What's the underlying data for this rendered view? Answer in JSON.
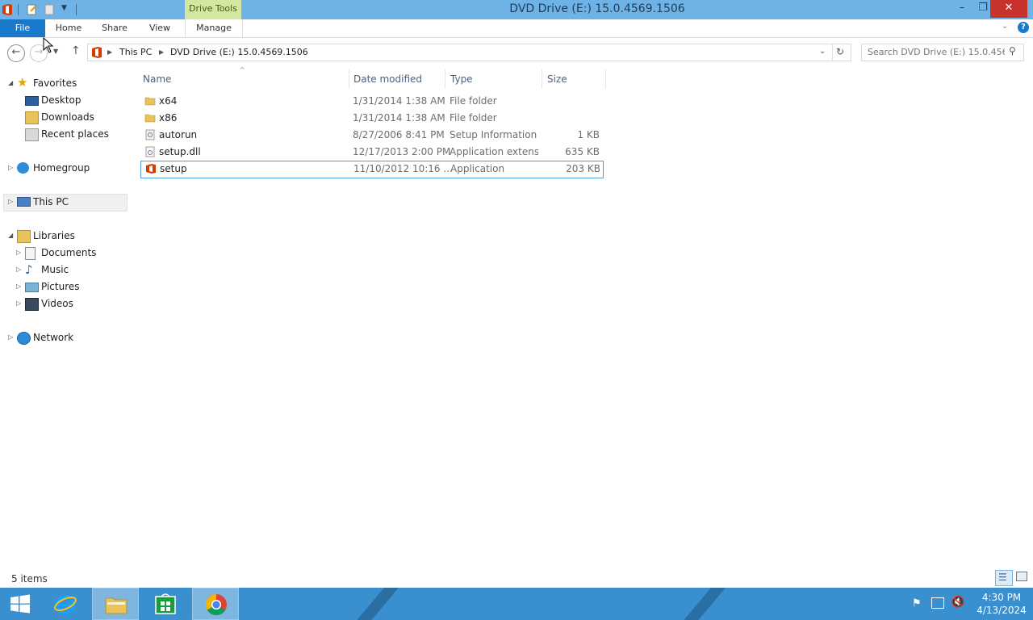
{
  "window": {
    "title": "DVD Drive (E:) 15.0.4569.1506",
    "contextual_tab": "Drive Tools"
  },
  "ribbon": {
    "tabs": [
      {
        "label": "File"
      },
      {
        "label": "Home"
      },
      {
        "label": "Share"
      },
      {
        "label": "View"
      },
      {
        "label": "Manage"
      }
    ]
  },
  "address": {
    "crumbs": [
      "This PC",
      "DVD Drive (E:) 15.0.4569.1506"
    ],
    "search_placeholder": "Search DVD Drive (E:) 15.0.456..."
  },
  "nav": {
    "favorites": {
      "label": "Favorites",
      "items": [
        "Desktop",
        "Downloads",
        "Recent places"
      ]
    },
    "homegroup": "Homegroup",
    "this_pc": "This PC",
    "libraries": {
      "label": "Libraries",
      "items": [
        "Documents",
        "Music",
        "Pictures",
        "Videos"
      ]
    },
    "network": "Network"
  },
  "columns": {
    "name": "Name",
    "date": "Date modified",
    "type": "Type",
    "size": "Size"
  },
  "files": [
    {
      "name": "x64",
      "date": "1/31/2014 1:38 AM",
      "type": "File folder",
      "size": "",
      "icon": "folder-icon"
    },
    {
      "name": "x86",
      "date": "1/31/2014 1:38 AM",
      "type": "File folder",
      "size": "",
      "icon": "folder-icon"
    },
    {
      "name": "autorun",
      "date": "8/27/2006 8:41 PM",
      "type": "Setup Information",
      "size": "1 KB",
      "icon": "setup-info-icon"
    },
    {
      "name": "setup.dll",
      "date": "12/17/2013 2:00 PM",
      "type": "Application extens...",
      "size": "635 KB",
      "icon": "dll-icon"
    },
    {
      "name": "setup",
      "date": "11/10/2012 10:16 ...",
      "type": "Application",
      "size": "203 KB",
      "icon": "office-icon"
    }
  ],
  "status": {
    "item_count": "5 items"
  },
  "clock": {
    "time": "4:30 PM",
    "date": "4/13/2024"
  },
  "colors": {
    "title_bar": "#6fb3e6",
    "file_tab": "#1979ca",
    "taskbar": "#3a8fcf",
    "drive_tools": "#d4e7a0",
    "close": "#c7332c"
  }
}
